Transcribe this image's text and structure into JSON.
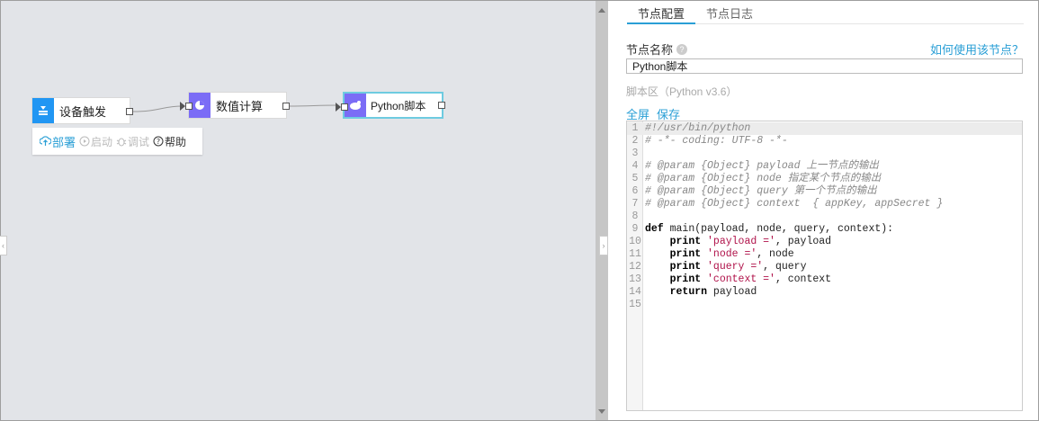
{
  "canvas": {
    "background": "#e2e4e8",
    "nodes": [
      {
        "label": "设备触发",
        "icon": "device-trigger-icon",
        "color": "#2196f3"
      },
      {
        "label": "数值计算",
        "icon": "pie-chart-icon",
        "color": "#7b6cf6"
      },
      {
        "label": "Python脚本",
        "icon": "python-icon",
        "color": "#7b6cf6"
      }
    ],
    "toolbar": {
      "deploy": "部署",
      "start": "启动",
      "debug": "调试",
      "help": "帮助"
    }
  },
  "panel": {
    "tabs": [
      {
        "label": "节点配置",
        "active": true
      },
      {
        "label": "节点日志",
        "active": false
      }
    ],
    "node_name_label": "节点名称",
    "help_link": "如何使用该节点？",
    "node_name_value": "Python脚本",
    "script_area_label": "脚本区（Python v3.6）",
    "fullscreen": "全屏",
    "save": "保存",
    "accent_color": "#2a9fd6",
    "code_lines": [
      {
        "n": "1",
        "text": "#!/usr/bin/python"
      },
      {
        "n": "2",
        "text": "# -*- coding: UTF-8 -*-"
      },
      {
        "n": "3",
        "text": ""
      },
      {
        "n": "4",
        "text": "# @param {Object} payload 上一节点的输出"
      },
      {
        "n": "5",
        "text": "# @param {Object} node 指定某个节点的输出"
      },
      {
        "n": "6",
        "text": "# @param {Object} query 第一个节点的输出"
      },
      {
        "n": "7",
        "text": "# @param {Object} context  { appKey, appSecret }"
      },
      {
        "n": "8",
        "text": ""
      },
      {
        "n": "9",
        "text": "def main(payload, node, query, context):"
      },
      {
        "n": "10",
        "text": "    print 'payload =', payload"
      },
      {
        "n": "11",
        "text": "    print 'node =', node"
      },
      {
        "n": "12",
        "text": "    print 'query =', query"
      },
      {
        "n": "13",
        "text": "    print 'context =', context"
      },
      {
        "n": "14",
        "text": "    return payload"
      },
      {
        "n": "15",
        "text": ""
      }
    ]
  }
}
